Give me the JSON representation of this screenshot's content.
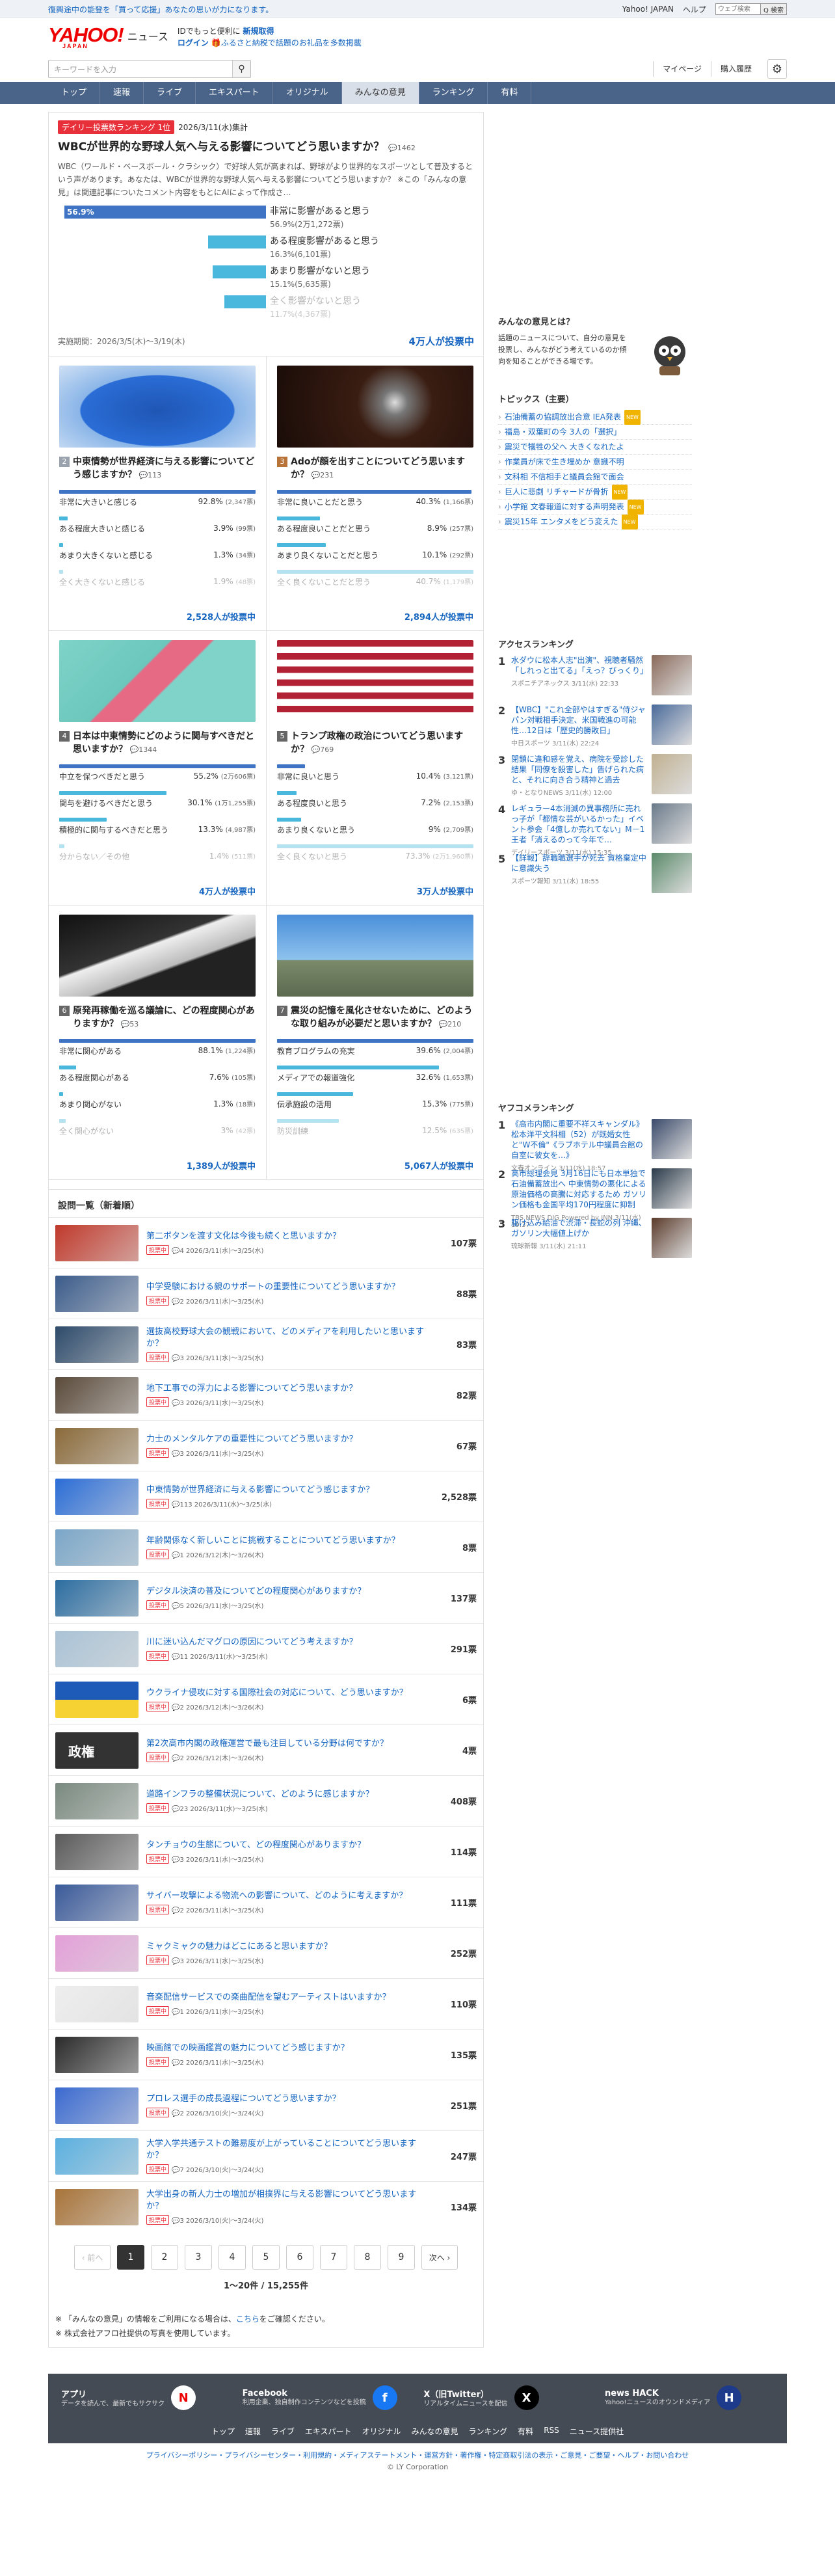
{
  "promo": {
    "text": "復興途中の能登を「買って応援」あなたの思いが力になります。"
  },
  "toplinks": [
    "Yahoo! JAPAN",
    "ヘルプ"
  ],
  "mini_search": {
    "placeholder": "ウェブ検索",
    "button": "Q 検索"
  },
  "logo": {
    "main": "YAHOO!",
    "sub": "JAPAN",
    "news": "ニュース"
  },
  "logo_msg": {
    "line1": "IDでもっと便利に",
    "line1_b": "新規取得",
    "line2_login": "ログイン",
    "line2": "ふるさと納税で話題のお礼品を多数掲載"
  },
  "search": {
    "placeholder": "キーワードを入力",
    "mypage": "マイページ",
    "purchase": "購入履歴"
  },
  "nav": [
    "トップ",
    "速報",
    "ライブ",
    "エキスパート",
    "オリジナル",
    "みんなの意見",
    "ランキング",
    "有料"
  ],
  "featured": {
    "tag": "デイリー投票数ランキング 1位",
    "date": "2026/3/11(水)集計",
    "title": "WBCが世界的な野球人気へ与える影響についてどう思いますか？",
    "comments": "1462",
    "desc": "WBC（ワールド・ベースボール・クラシック）で好球人気が高まれば、野球がより世界的なスポーツとして普及するという声があります。あなたは、WBCが世界的な野球人気へ与える影響についてどう思いますか？ ※この「みんなの意見」は関連記事についたコメント内容をもとにAIによって作成さ…",
    "options": [
      {
        "label": "非常に影響があると思う",
        "pct": "56.9%",
        "count": "(2万1,272票)",
        "value": 56.9
      },
      {
        "label": "ある程度影響があると思う",
        "pct": "16.3%",
        "count": "(6,101票)",
        "value": 16.3
      },
      {
        "label": "あまり影響がないと思う",
        "pct": "15.1%",
        "count": "(5,635票)",
        "value": 15.1
      },
      {
        "label": "全く影響がないと思う",
        "pct": "11.7%",
        "count": "(4,367票)",
        "value": 11.7
      }
    ],
    "period": "実施期間：2026/3/5(木)〜3/19(木)",
    "votes": "4万人が投票中"
  },
  "cards": [
    {
      "num": "2",
      "title": "中東情勢が世界経済に与える影響についてどう感じますか？",
      "comments": "113",
      "options": [
        {
          "label": "非常に大きいと感じる",
          "pct": "92.8%",
          "count": "(2,347票)",
          "value": 92.8
        },
        {
          "label": "ある程度大きいと感じる",
          "pct": "3.9%",
          "count": "(99票)",
          "value": 3.9
        },
        {
          "label": "あまり大きくないと感じる",
          "pct": "1.3%",
          "count": "(34票)",
          "value": 1.3
        },
        {
          "label": "全く大きくないと感じる",
          "pct": "1.9%",
          "count": "(48票)",
          "value": 1.9
        }
      ],
      "votes": "2,528人が投票中"
    },
    {
      "num": "3",
      "title": "Adoが顔を出すことについてどう思いますか？",
      "comments": "231",
      "options": [
        {
          "label": "非常に良いことだと思う",
          "pct": "40.3%",
          "count": "(1,166票)",
          "value": 40.3
        },
        {
          "label": "ある程度良いことだと思う",
          "pct": "8.9%",
          "count": "(257票)",
          "value": 8.9
        },
        {
          "label": "あまり良くないことだと思う",
          "pct": "10.1%",
          "count": "(292票)",
          "value": 10.1
        },
        {
          "label": "全く良くないことだと思う",
          "pct": "40.7%",
          "count": "(1,179票)",
          "value": 40.7
        }
      ],
      "votes": "2,894人が投票中"
    },
    {
      "num": "4",
      "title": "日本は中東情勢にどのように関与すべきだと思いますか？",
      "comments": "1344",
      "options": [
        {
          "label": "中立を保つべきだと思う",
          "pct": "55.2%",
          "count": "(2万606票)",
          "value": 55.2
        },
        {
          "label": "関与を避けるべきだと思う",
          "pct": "30.1%",
          "count": "(1万1,255票)",
          "value": 30.1
        },
        {
          "label": "積極的に関与するべきだと思う",
          "pct": "13.3%",
          "count": "(4,987票)",
          "value": 13.3
        },
        {
          "label": "分からない／その他",
          "pct": "1.4%",
          "count": "(511票)",
          "value": 1.4
        }
      ],
      "votes": "4万人が投票中"
    },
    {
      "num": "5",
      "title": "トランプ政権の政治についてどう思いますか？",
      "comments": "769",
      "options": [
        {
          "label": "非常に良いと思う",
          "pct": "10.4%",
          "count": "(3,121票)",
          "value": 10.4
        },
        {
          "label": "ある程度良いと思う",
          "pct": "7.2%",
          "count": "(2,153票)",
          "value": 7.2
        },
        {
          "label": "あまり良くないと思う",
          "pct": "9%",
          "count": "(2,709票)",
          "value": 9
        },
        {
          "label": "全く良くないと思う",
          "pct": "73.3%",
          "count": "(2万1,960票)",
          "value": 73.3
        }
      ],
      "votes": "3万人が投票中"
    },
    {
      "num": "6",
      "title": "原発再稼働を巡る議論に、どの程度関心がありますか？",
      "comments": "53",
      "options": [
        {
          "label": "非常に関心がある",
          "pct": "88.1%",
          "count": "(1,224票)",
          "value": 88.1
        },
        {
          "label": "ある程度関心がある",
          "pct": "7.6%",
          "count": "(105票)",
          "value": 7.6
        },
        {
          "label": "あまり関心がない",
          "pct": "1.3%",
          "count": "(18票)",
          "value": 1.3
        },
        {
          "label": "全く関心がない",
          "pct": "3%",
          "count": "(42票)",
          "value": 3
        }
      ],
      "votes": "1,389人が投票中"
    },
    {
      "num": "7",
      "title": "震災の記憶を風化させないために、どのような取り組みが必要だと思いますか？",
      "comments": "210",
      "options": [
        {
          "label": "教育プログラムの充実",
          "pct": "39.6%",
          "count": "(2,004票)",
          "value": 39.6
        },
        {
          "label": "メディアでの報道強化",
          "pct": "32.6%",
          "count": "(1,653票)",
          "value": 32.6
        },
        {
          "label": "伝承施設の活用",
          "pct": "15.3%",
          "count": "(775票)",
          "value": 15.3
        },
        {
          "label": "防災訓練",
          "pct": "12.5%",
          "count": "(635票)",
          "value": 12.5
        }
      ],
      "votes": "5,067人が投票中"
    }
  ],
  "list_head": "設問一覧（新着順）",
  "items": [
    {
      "title": "第二ボタンを渡す文化は今後も続くと思いますか？",
      "meta": "4  2026/3/11(水)〜3/25(水)",
      "votes": "107票"
    },
    {
      "title": "中学受験における親のサポートの重要性についてどう思いますか？",
      "meta": "2  2026/3/11(水)〜3/25(水)",
      "votes": "88票"
    },
    {
      "title": "選抜高校野球大会の観戦において、どのメディアを利用したいと思いますか？",
      "meta": "3  2026/3/11(水)〜3/25(水)",
      "votes": "83票"
    },
    {
      "title": "地下工事での浮力による影響についてどう思いますか？",
      "meta": "3  2026/3/11(水)〜3/25(水)",
      "votes": "82票"
    },
    {
      "title": "力士のメンタルケアの重要性についてどう思いますか？",
      "meta": "3  2026/3/11(水)〜3/25(水)",
      "votes": "67票"
    },
    {
      "title": "中東情勢が世界経済に与える影響についてどう感じますか？",
      "meta": "113  2026/3/11(水)〜3/25(水)",
      "votes": "2,528票"
    },
    {
      "title": "年齢関係なく新しいことに挑戦することについてどう思いますか？",
      "meta": "1  2026/3/12(木)〜3/26(木)",
      "votes": "8票"
    },
    {
      "title": "デジタル決済の普及についてどの程度関心がありますか？",
      "meta": "5  2026/3/11(水)〜3/25(水)",
      "votes": "137票"
    },
    {
      "title": "川に迷い込んだマグロの原因についてどう考えますか？",
      "meta": "11  2026/3/11(水)〜3/25(水)",
      "votes": "291票"
    },
    {
      "title": "ウクライナ侵攻に対する国際社会の対応について、どう思いますか？",
      "meta": "2  2026/3/12(木)〜3/26(木)",
      "votes": "6票"
    },
    {
      "title": "第2次高市内閣の政権運営で最も注目している分野は何ですか？",
      "meta": "2  2026/3/12(木)〜3/26(木)",
      "votes": "4票"
    },
    {
      "title": "道路インフラの整備状況について、どのように感じますか？",
      "meta": "23  2026/3/11(水)〜3/25(水)",
      "votes": "408票"
    },
    {
      "title": "タンチョウの生態について、どの程度関心がありますか？",
      "meta": "3  2026/3/11(水)〜3/25(水)",
      "votes": "114票"
    },
    {
      "title": "サイバー攻撃による物流への影響について、どのように考えますか？",
      "meta": "2  2026/3/11(水)〜3/25(水)",
      "votes": "111票"
    },
    {
      "title": "ミャクミャクの魅力はどこにあると思いますか？",
      "meta": "3  2026/3/11(水)〜3/25(水)",
      "votes": "252票"
    },
    {
      "title": "音楽配信サービスでの楽曲配信を望むアーティストはいますか？",
      "meta": "1  2026/3/11(水)〜3/25(水)",
      "votes": "110票"
    },
    {
      "title": "映画館での映画鑑賞の魅力についてどう感じますか？",
      "meta": "2  2026/3/11(水)〜3/25(水)",
      "votes": "135票"
    },
    {
      "title": "プロレス選手の成長過程についてどう思いますか？",
      "meta": "2  2026/3/10(火)〜3/24(火)",
      "votes": "251票"
    },
    {
      "title": "大学入学共通テストの難易度が上がっていることについてどう思いますか？",
      "meta": "7  2026/3/10(火)〜3/24(火)",
      "votes": "247票"
    },
    {
      "title": "大学出身の新人力士の増加が相撲界に与える影響についてどう思いますか？",
      "meta": "3  2026/3/10(火)〜3/24(火)",
      "votes": "134票"
    }
  ],
  "badge_label": "投票中",
  "pager": {
    "prev": "‹ 前へ",
    "pages": [
      "1",
      "2",
      "3",
      "4",
      "5",
      "6",
      "7",
      "8",
      "9"
    ],
    "next": "次へ ›",
    "count": "1〜20件 / 15,255件"
  },
  "notes": {
    "n1_pre": "「みんなの意見」の情報をご利用になる場合は、",
    "n1_link": "こちら",
    "n1_post": "をご確認ください。",
    "n2": "株式会社アフロ社提供の写真を使用しています。"
  },
  "side": {
    "q_head": "みんなの意見とは？",
    "q_desc": "話題のニュースについて、自分の意見を投票し、みんながどう考えているのか傾向を知ることができる場です。",
    "topics_head": "トピックス（主要）",
    "topics": [
      {
        "t": "石油備蓄の協調放出合意 IEA発表",
        "tag": "NEW"
      },
      {
        "t": "福島・双葉町の今 3人の「選択」",
        "tag": ""
      },
      {
        "t": "震災で犠牲の父へ 大きくなれたよ",
        "tag": ""
      },
      {
        "t": "作業員が床で生き埋めか 意識不明",
        "tag": ""
      },
      {
        "t": "文科相 不信相手と議員会館で面会",
        "tag": ""
      },
      {
        "t": "巨人に悲劇 リチャードが骨折",
        "tag": "NEW"
      },
      {
        "t": "小学館 文春報道に対する声明発表",
        "tag": "NEW"
      },
      {
        "t": "震災15年 エンタメをどう変えた",
        "tag": "NEW"
      }
    ],
    "rank_head": "アクセスランキング",
    "ranking": [
      {
        "n": "1",
        "t": "水ダウに松本人志\"出演\"、視聴者騒然「しれっと出てる」「えっ？びっくり」",
        "s": "スポニチアネックス 3/11(水) 22:33"
      },
      {
        "n": "2",
        "t": "【WBC】\"これ全部やはすぎる\"侍ジャパン対戦相手決定、米国戦進の可能性…12日は「歴史的勝敗日」",
        "s": "中日スポーツ 3/11(水) 22:24"
      },
      {
        "n": "3",
        "t": "閉鎖に違和感を覚え、病院を受診した結果「同僚を殺害した」告げられた病と、それに向き合う精神と過去",
        "s": "ゆ・となりNEWS 3/11(水) 12:00"
      },
      {
        "n": "4",
        "t": "レギュラー4本消滅の異事務所に売れっ子が「都情な芸がいるかった」イベント参会「4億しか売れてない」M－1王者「消えるのって今年で…",
        "s": "デイリースポーツ 3/11(水) 15:35"
      },
      {
        "n": "5",
        "t": "【詳報】辞職職選手が死去 資格棄定中に意識失う",
        "s": "スポーツ報知 3/11(水) 18:55"
      }
    ],
    "rank2_head": "ヤフコメランキング",
    "ranking2": [
      {
        "n": "1",
        "t": "《高市内閣に重要不祥スキャンダル》松本洋平文科相（52）が既婚女性と\"W不倫\"《ラブホテル中議員会館の自室に彼女を…》",
        "s": "文春オンライン 3/11(水) 18:57"
      },
      {
        "n": "2",
        "t": "高市総理会見 3月16日にも日本単独で石油備蓄放出へ 中東情勢の悪化による原油価格の高騰に対応するため ガソリン価格も金国平均170円程度に抑制",
        "s": "TBS NEWS DIG Powered by JNN 3/11(水) 19:37"
      },
      {
        "n": "3",
        "t": "駆け込み給油で渋滞・長蛇の列 沖縄、ガソリン大幅値上げか",
        "s": "琉球新報 3/11(水) 21:11"
      }
    ]
  },
  "footer": {
    "apps": [
      {
        "name": "アプリ",
        "desc": "データを読んで、最新でもサクサク"
      },
      {
        "name": "Facebook",
        "desc": "利用企業、独自制作コンテンツなどを投稿"
      },
      {
        "name": "X（旧Twitter）",
        "desc": "リアルタイムニュースを配信"
      },
      {
        "name": "news HACK",
        "desc": "Yahoo!ニュースのオウンドメディア"
      }
    ],
    "links": [
      "トップ",
      "速報",
      "ライブ",
      "エキスパート",
      "オリジナル",
      "みんなの意見",
      "ランキング",
      "有料",
      "RSS",
      "ニュース提供社"
    ],
    "bottom": "プライバシーポリシー・プライバシーセンター・利用規約・メディアステートメント・運営方針・著作権・特定商取引法の表示・ご意見・ご要望・ヘルプ・お問い合わせ",
    "copy": "© LY Corporation"
  },
  "colors": {
    "nav": "#4a6389",
    "accent": "#1565c0",
    "bar": "#3f74c4",
    "bar_other": "#49b8dc",
    "red": "#e8303a"
  }
}
